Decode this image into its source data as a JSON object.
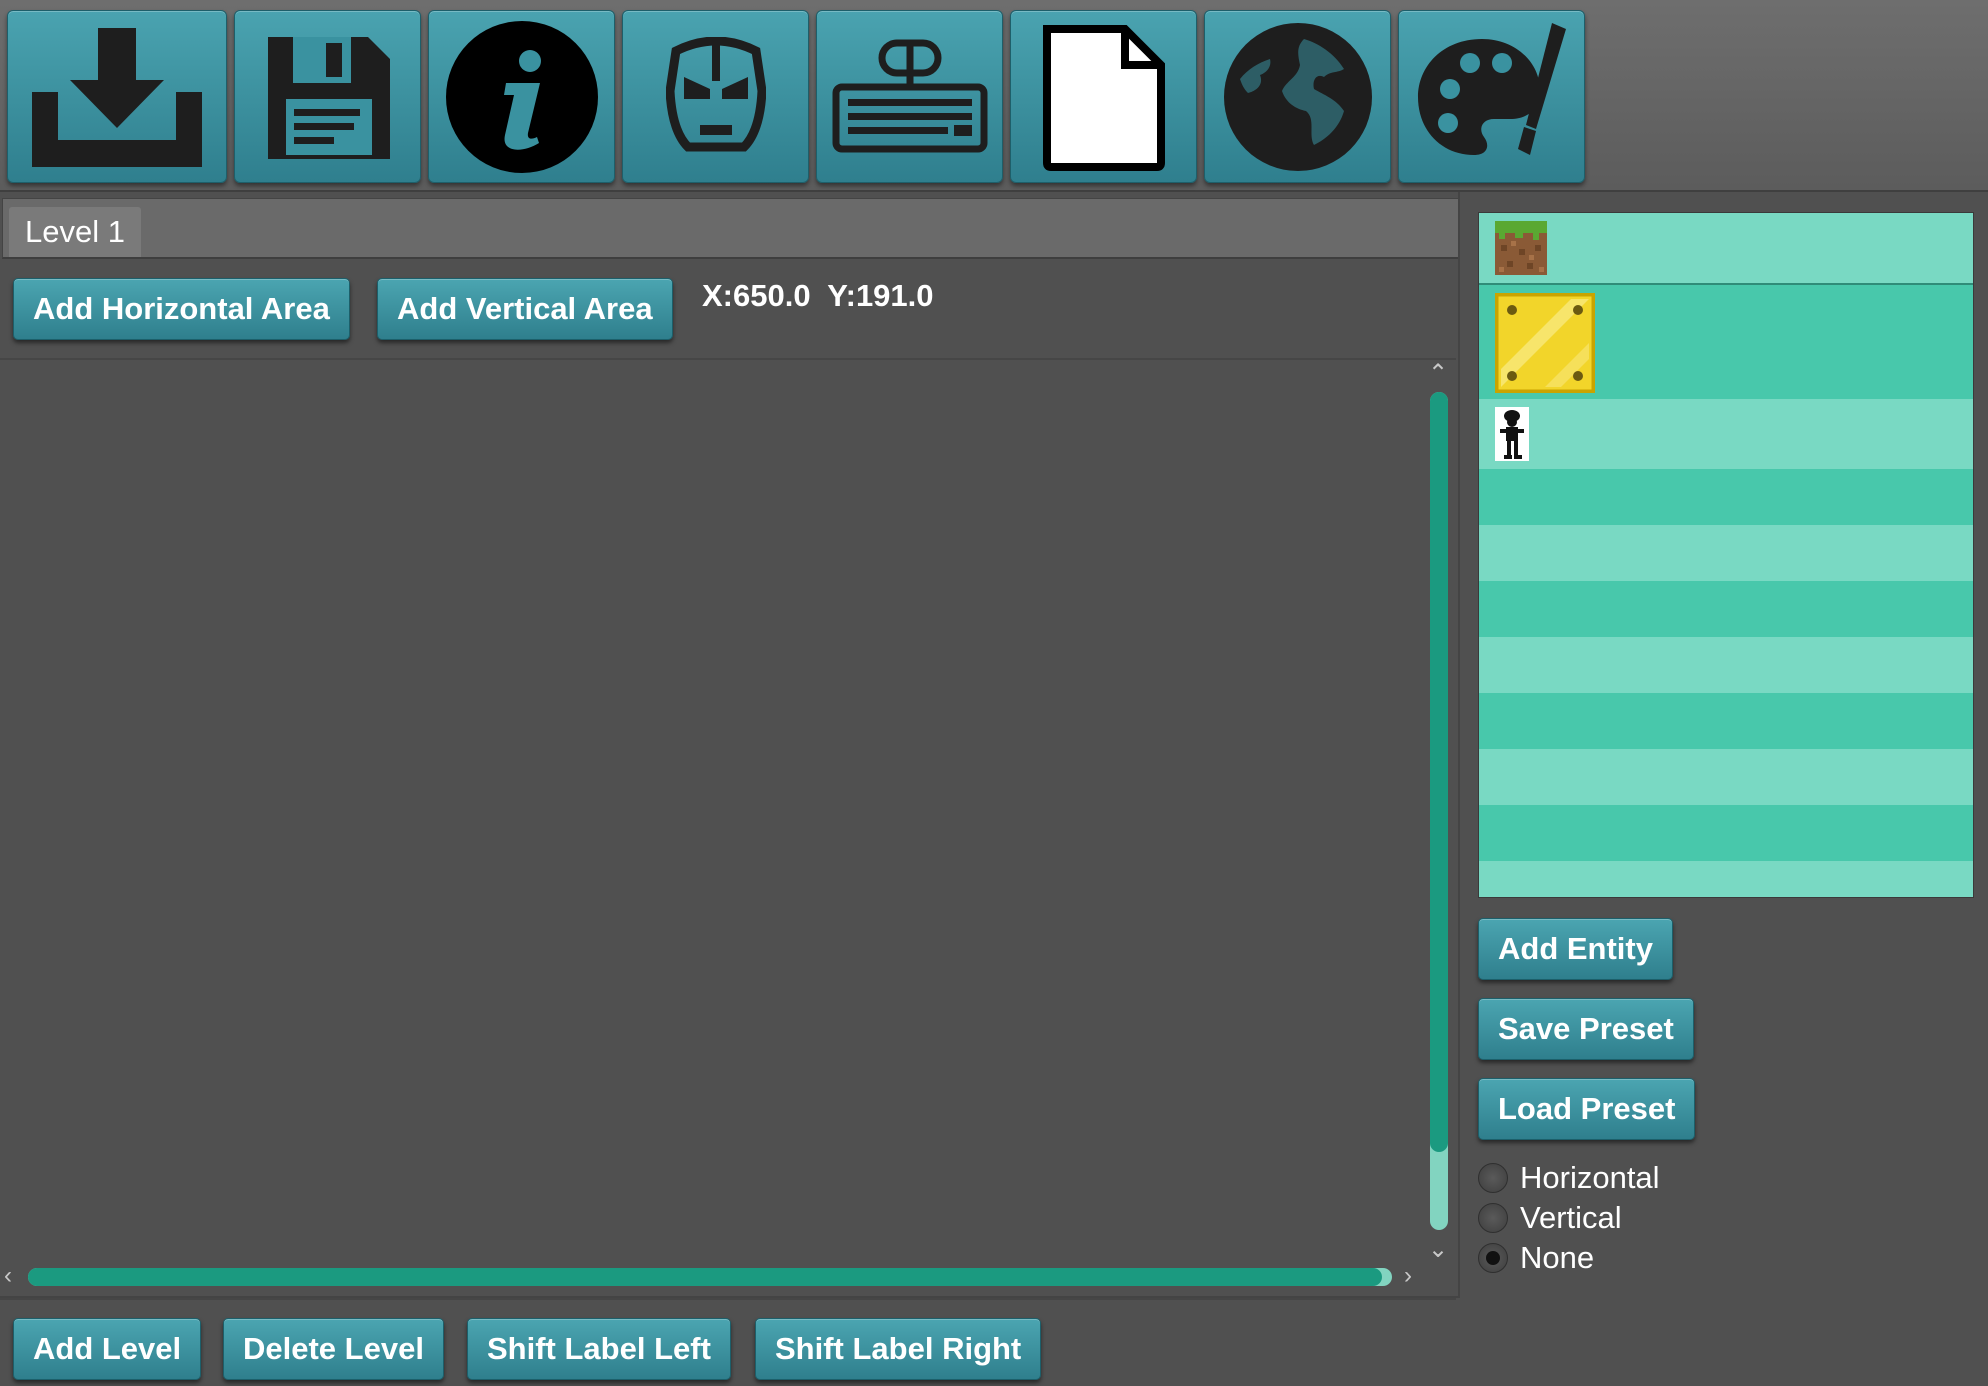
{
  "toolbar": {
    "buttons": [
      {
        "icon": "download-icon"
      },
      {
        "icon": "floppy-disk-icon"
      },
      {
        "icon": "info-icon"
      },
      {
        "icon": "iron-man-mask-icon"
      },
      {
        "icon": "keyboard-mouse-icon"
      },
      {
        "icon": "blank-document-icon"
      },
      {
        "icon": "globe-icon"
      },
      {
        "icon": "paint-palette-icon"
      }
    ]
  },
  "tabs": [
    {
      "label": "Level 1"
    }
  ],
  "area_controls": {
    "add_horizontal": "Add Horizontal Area",
    "add_vertical": "Add Vertical Area",
    "coords": "X:650.0  Y:191.0"
  },
  "entity_list": {
    "items": [
      {
        "icon": "dirt-grass-block-icon"
      },
      {
        "icon": "yellow-block-icon"
      },
      {
        "icon": "character-sprite-icon"
      }
    ]
  },
  "entity_actions": {
    "add_entity": "Add Entity",
    "save_preset": "Save Preset",
    "load_preset": "Load Preset"
  },
  "orientation": {
    "options": [
      {
        "label": "Horizontal",
        "checked": false
      },
      {
        "label": "Vertical",
        "checked": false
      },
      {
        "label": "None",
        "checked": true
      }
    ]
  },
  "level_actions": {
    "add_level": "Add Level",
    "delete_level": "Delete Level",
    "shift_left": "Shift Label Left",
    "shift_right": "Shift Label Right"
  },
  "colors": {
    "button_teal": "#3a92a0",
    "scroll_thumb": "#1b9a80",
    "scroll_track": "#82d4c0",
    "list_light": "#79d9c3",
    "list_dark": "#48c8ab",
    "background": "#505050"
  }
}
